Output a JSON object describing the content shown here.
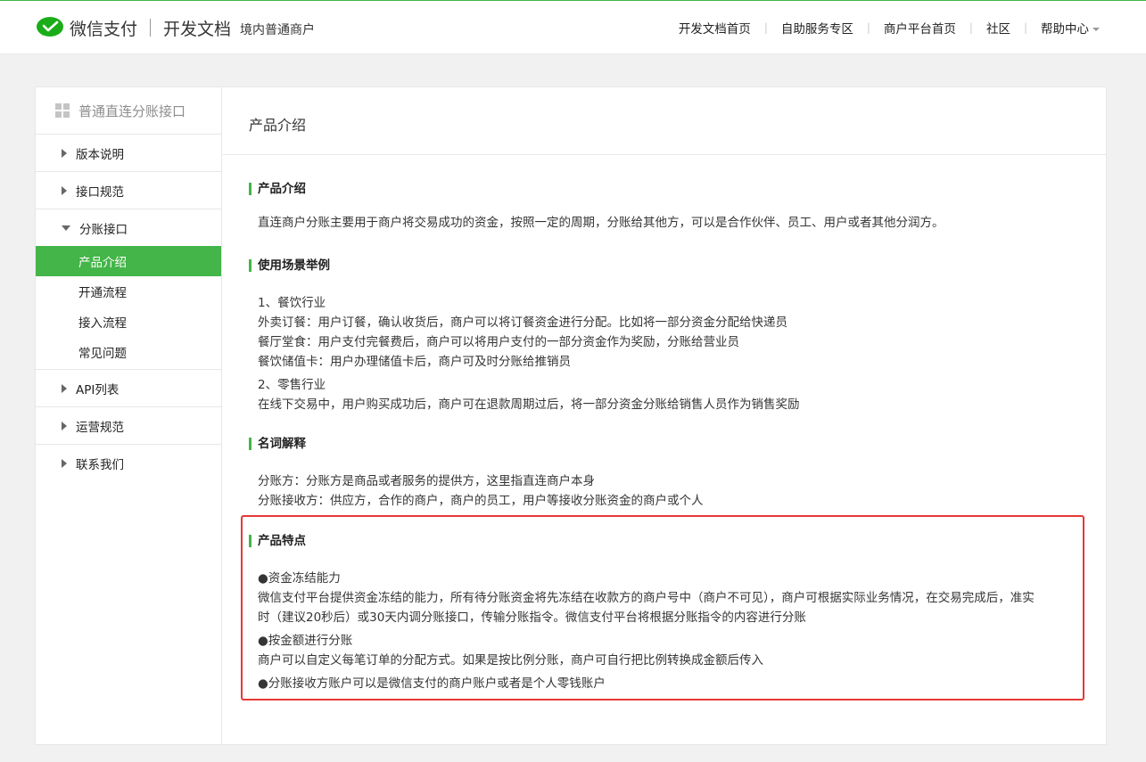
{
  "header": {
    "brand": "微信支付",
    "doc_title": "开发文档",
    "sub_title": "境内普通商户",
    "nav": [
      "开发文档首页",
      "自助服务专区",
      "商户平台首页",
      "社区",
      "帮助中心"
    ]
  },
  "sidebar": {
    "title": "普通直连分账接口",
    "groups": [
      {
        "label": "版本说明",
        "expanded": false
      },
      {
        "label": "接口规范",
        "expanded": false
      },
      {
        "label": "分账接口",
        "expanded": true,
        "items": [
          "产品介绍",
          "开通流程",
          "接入流程",
          "常见问题"
        ],
        "active": "产品介绍"
      },
      {
        "label": "API列表",
        "expanded": false
      },
      {
        "label": "运营规范",
        "expanded": false
      },
      {
        "label": "联系我们",
        "expanded": false
      }
    ]
  },
  "main": {
    "page_title": "产品介绍",
    "sections": [
      {
        "heading": "产品介绍",
        "lines": [
          "直连商户分账主要用于商户将交易成功的资金，按照一定的周期，分账给其他方，可以是合作伙伴、员工、用户或者其他分润方。"
        ]
      },
      {
        "heading": "使用场景举例",
        "lines": [
          "1、餐饮行业",
          "外卖订餐：用户订餐，确认收货后，商户可以将订餐资金进行分配。比如将一部分资金分配给快递员",
          "餐厅堂食：用户支付完餐费后，商户可以将用户支付的一部分资金作为奖励，分账给营业员",
          "餐饮储值卡：用户办理储值卡后，商户可及时分账给推销员",
          "2、零售行业",
          "在线下交易中，用户购买成功后，商户可在退款周期过后，将一部分资金分账给销售人员作为销售奖励"
        ]
      },
      {
        "heading": "名词解释",
        "lines": [
          "分账方：分账方是商品或者服务的提供方，这里指直连商户本身",
          "分账接收方：供应方，合作的商户，商户的员工，用户等接收分账资金的商户或个人"
        ]
      },
      {
        "heading": "产品特点",
        "lines": [
          "●资金冻结能力",
          "微信支付平台提供资金冻结的能力，所有待分账资金将先冻结在收款方的商户号中（商户不可见），商户可根据实际业务情况，在交易完成后，准实",
          "时（建议20秒后）或30天内调分账接口，传输分账指令。微信支付平台将根据分账指令的内容进行分账",
          "●按金额进行分账",
          "商户可以自定义每笔订单的分配方式。如果是按比例分账，商户可自行把比例转换成金额后传入",
          "●分账接收方账户可以是微信支付的商户账户或者是个人零钱账户"
        ]
      }
    ]
  },
  "colors": {
    "accent": "#44b549",
    "highlight": "#e53935"
  }
}
